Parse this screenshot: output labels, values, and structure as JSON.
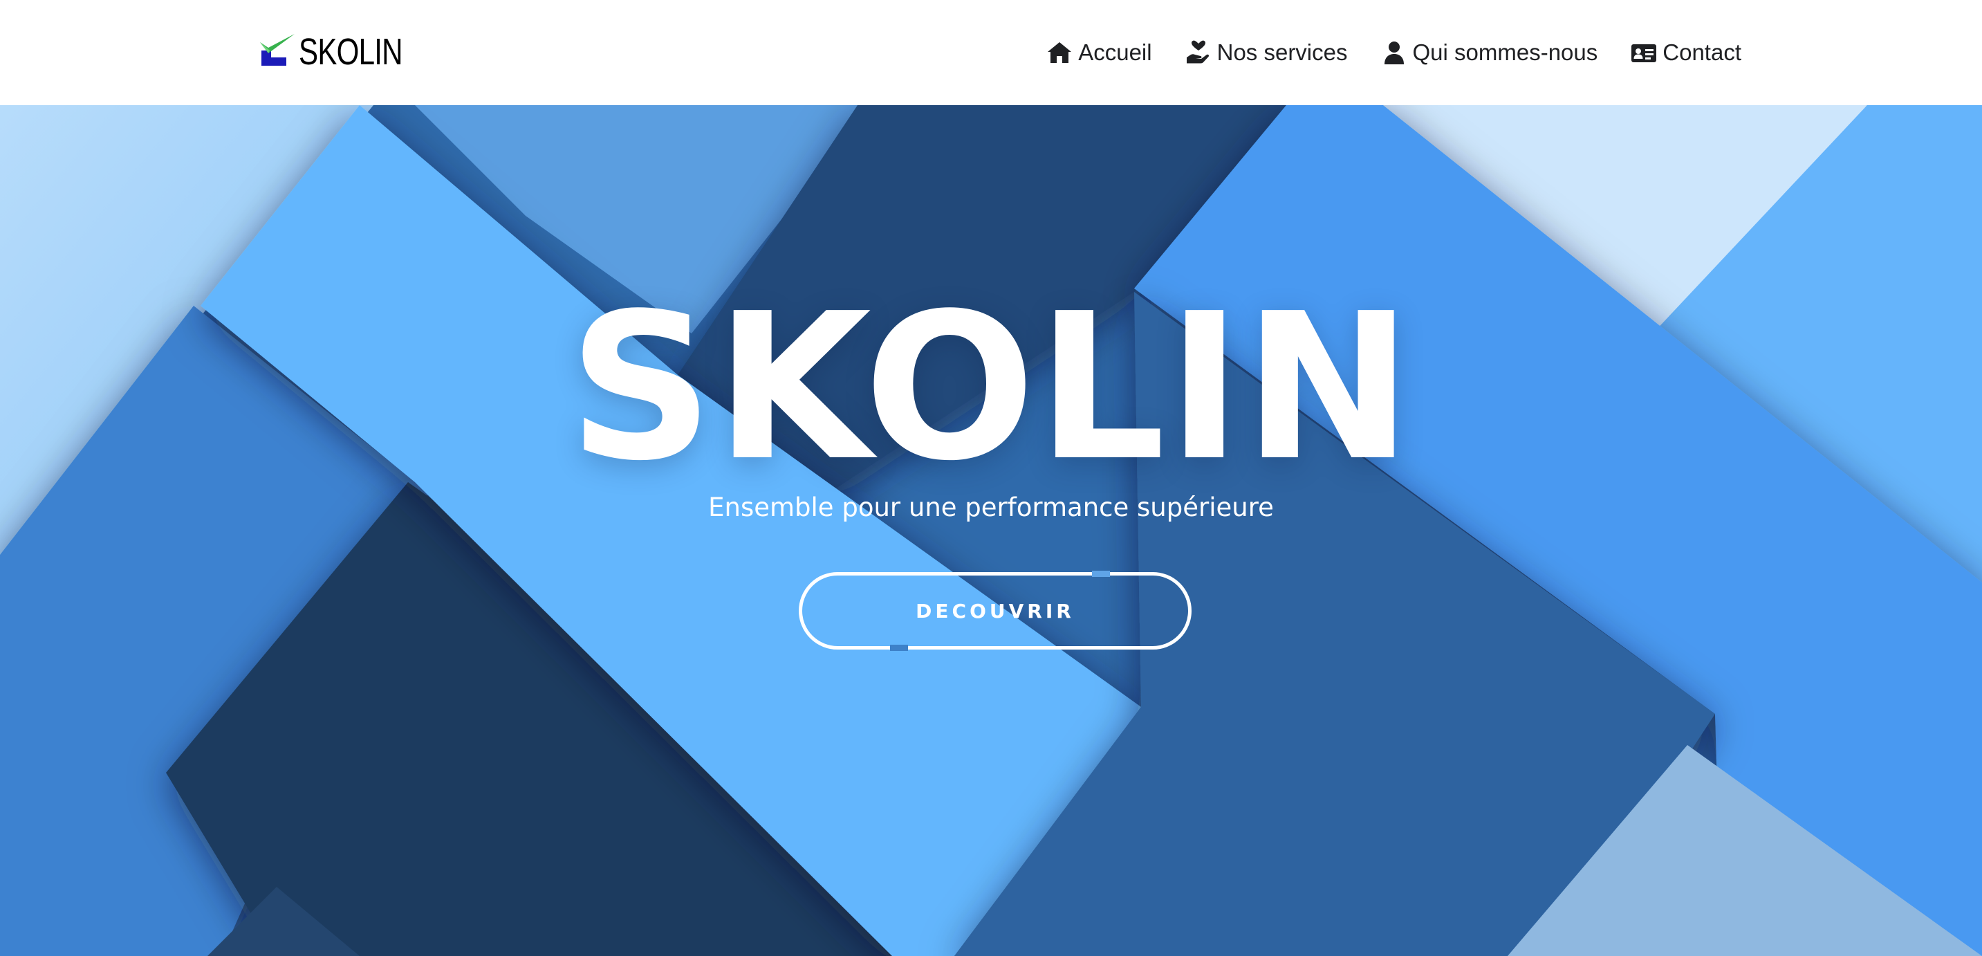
{
  "header": {
    "logo_text": "SKOLIN",
    "nav": [
      {
        "label": "Accueil",
        "icon": "home-icon"
      },
      {
        "label": "Nos services",
        "icon": "hand-heart-icon"
      },
      {
        "label": "Qui sommes-nous",
        "icon": "user-icon"
      },
      {
        "label": "Contact",
        "icon": "id-card-icon"
      }
    ]
  },
  "hero": {
    "title": "SKOLIN",
    "subtitle": "Ensemble pour une performance supérieure",
    "button_label": "DECOUVRIR"
  },
  "colors": {
    "light_blue": "#a9d6fb",
    "sky_blue": "#63b6fd",
    "mid_blue": "#4a9af3",
    "steel_blue": "#2e63a0",
    "navy": "#1a3a5f",
    "dark_navy": "#203f66",
    "pale_blue": "#cbe5fb",
    "white": "#ffffff",
    "nav_text": "#1f2023"
  }
}
